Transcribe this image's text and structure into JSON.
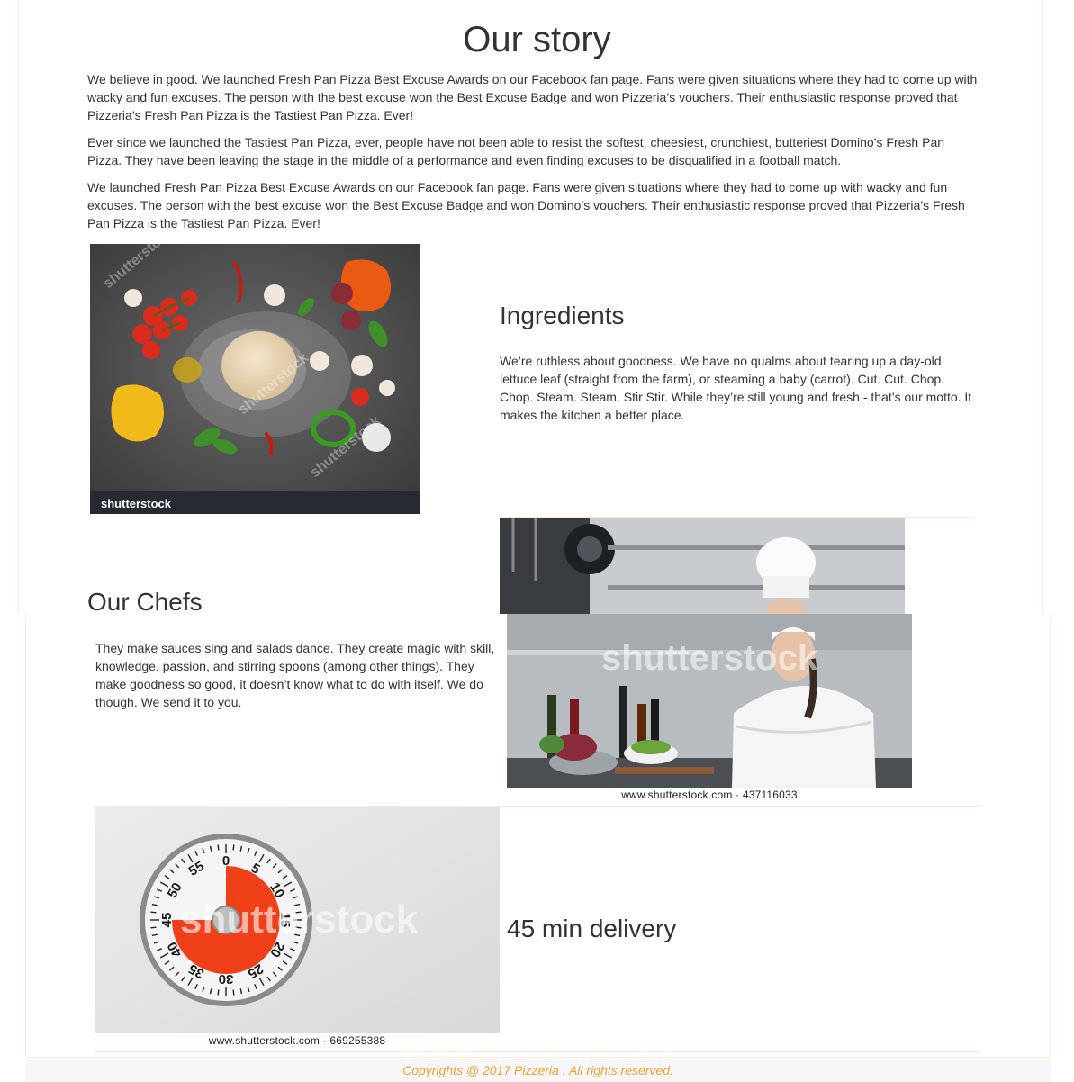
{
  "story": {
    "title": "Our story",
    "paragraphs": [
      "We believe in good. We launched Fresh Pan Pizza Best Excuse Awards on our Facebook fan page. Fans were given situations where they had to come up with wacky and fun excuses. The person with the best excuse won the Best Excuse Badge and won Pizzeria’s vouchers. Their enthusiastic response proved that Pizzeria’s Fresh Pan Pizza is the Tastiest Pan Pizza. Ever!",
      "Ever since we launched the Tastiest Pan Pizza, ever, people have not been able to resist the softest, cheesiest, crunchiest, butteriest Domino’s Fresh Pan Pizza. They have been leaving the stage in the middle of a performance and even finding excuses to be disqualified in a football match.",
      "We launched Fresh Pan Pizza Best Excuse Awards on our Facebook fan page. Fans were given situations where they had to come up with wacky and fun excuses. The person with the best excuse won the Best Excuse Badge and won Domino’s vouchers. Their enthusiastic response proved that Pizzeria’s Fresh Pan Pizza is the Tastiest Pan Pizza. Ever!"
    ]
  },
  "ingredients": {
    "title": "Ingredients",
    "text": "We’re ruthless about goodness. We have no qualms about tearing up a day-old lettuce leaf (straight from the farm), or steaming a baby (carrot). Cut. Cut. Chop. Chop. Steam. Steam. Stir Stir. While they’re still young and fresh - that’s our motto. It makes the kitchen a better place.",
    "watermark": "shutterstock"
  },
  "chefs": {
    "title": "Our Chefs",
    "text": "They make sauces sing and salads dance. They create magic with skill, knowledge, passion, and stirring spoons (among other things). They make goodness so good, it doesn’t know what to do with itself. We do though. We send it to you.",
    "watermark": "shutterstock",
    "caption": "www.shutterstock.com · 437116033"
  },
  "delivery": {
    "title": "45 min delivery",
    "watermark": "shutterstock",
    "caption": "www.shutterstock.com · 669255388",
    "timer_numbers": [
      "0",
      "5",
      "10",
      "15",
      "20",
      "25",
      "30",
      "35",
      "40",
      "45",
      "50",
      "55"
    ]
  },
  "footer": {
    "text": "Copyrights @ 2017 Pizzeria . All rights reserved."
  },
  "colors": {
    "accent": "#f0a030",
    "border": "#faebd2",
    "text": "#333333"
  }
}
